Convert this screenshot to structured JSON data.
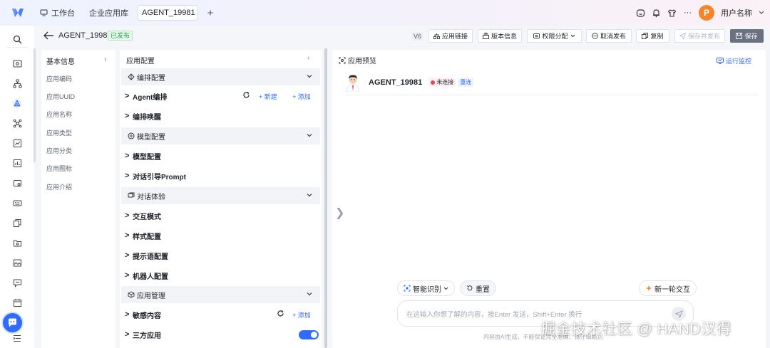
{
  "topbar": {
    "home_tab": "工作台",
    "lib_tab": "企业应用库",
    "active_tab": "AGENT_19981",
    "add_tab": "+",
    "more": "···",
    "avatar_letter": "P",
    "user_name": "用户名称"
  },
  "header": {
    "agent_title": "AGENT_19981",
    "status_badge": "已发布",
    "version": "V6",
    "buttons": {
      "app_link": "应用链接",
      "version_info": "版本信息",
      "permission": "权限分配",
      "unpublish": "取消发布",
      "copy": "复制",
      "save_publish": "保存并发布",
      "save": "保存"
    }
  },
  "info_panel": {
    "title": "基本信息",
    "chevron": "›",
    "items": [
      "应用编码",
      "应用UUID",
      "应用名称",
      "应用类型",
      "应用分类",
      "应用图标",
      "应用介绍"
    ]
  },
  "config": {
    "title": "应用配置",
    "collapse": "‹",
    "groups": {
      "orchestration": "编排配置",
      "model": "模型配置",
      "dialog": "对话体验",
      "management": "应用管理"
    },
    "rows": {
      "agent_orch": "Agent编排",
      "orch_wake": "编排唤醒",
      "model_cfg": "模型配置",
      "dialog_prompt": "对话引导Prompt",
      "interaction": "交互模式",
      "style": "样式配置",
      "hint": "提示语配置",
      "robot": "机器人配置",
      "sensitive": "敏感内容",
      "third_party": "三方应用"
    },
    "actions": {
      "new": "+ 新建",
      "add": "+ 添加"
    },
    "arrow": ">"
  },
  "preview": {
    "title": "应用预览",
    "monitor": "运行监控",
    "agent_name": "AGENT_19981",
    "connection_status": "未连接",
    "reconnect": "重连",
    "expand_arrow": "❯",
    "smart_recognition": "智能识别",
    "reset": "重置",
    "new_round": "新一轮交互",
    "input_placeholder": "在这输入你想了解的内容，按Enter 发送，Shift+Enter 换行",
    "disclaimer": "内容由AI生成，不能保证完全准确，请仔细甄别"
  },
  "watermark": "掘金技术社区 @ HAND汉得",
  "colors": {
    "accent": "#2f6bff",
    "published": "#26a14a",
    "danger": "#e5455b",
    "save_bg": "#6b7180"
  }
}
